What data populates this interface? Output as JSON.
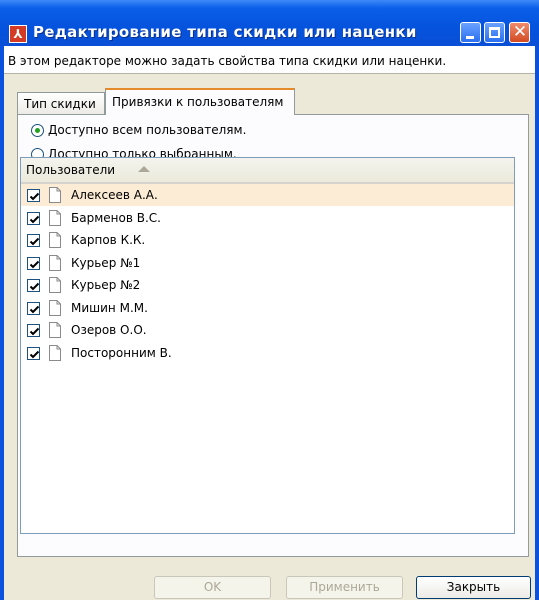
{
  "window": {
    "title": "Редактирование типа скидки или наценки",
    "description": "В этом редакторе можно задать свойства типа скидки или наценки."
  },
  "tabs": [
    {
      "label": "Тип скидки",
      "active": false
    },
    {
      "label": "Привязки к пользователям",
      "active": true
    }
  ],
  "access": {
    "options": [
      {
        "label": "Доступно всем пользователям.",
        "selected": true
      },
      {
        "label": "Доступно только выбранным.",
        "selected": false
      }
    ]
  },
  "users_list": {
    "column_header": "Пользователи",
    "sort": "ascending",
    "rows": [
      {
        "name": "Алексеев А.А.",
        "checked": true,
        "selected": true
      },
      {
        "name": "Барменов В.С.",
        "checked": true,
        "selected": false
      },
      {
        "name": "Карпов К.К.",
        "checked": true,
        "selected": false
      },
      {
        "name": "Курьер №1",
        "checked": true,
        "selected": false
      },
      {
        "name": "Курьер №2",
        "checked": true,
        "selected": false
      },
      {
        "name": "Мишин М.М.",
        "checked": true,
        "selected": false
      },
      {
        "name": "Озеров О.О.",
        "checked": true,
        "selected": false
      },
      {
        "name": "Посторонним В.",
        "checked": true,
        "selected": false
      }
    ]
  },
  "buttons": {
    "ok": "OK",
    "apply": "Применить",
    "close": "Закрыть"
  },
  "colors": {
    "titlebar": "#0553dd",
    "selected_row": "#fcecd5",
    "active_tab_accent": "#e68b2c"
  }
}
